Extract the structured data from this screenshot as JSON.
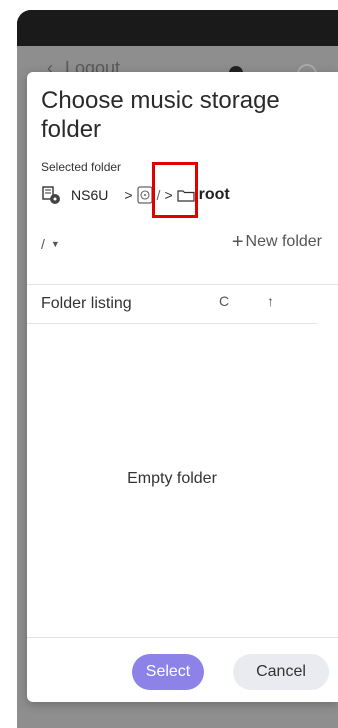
{
  "background_app": {
    "nav_label": "Logout"
  },
  "dialog": {
    "title": "Choose music storage folder",
    "selected_folder_label": "Selected folder",
    "breadcrumb": {
      "device": "NS6U",
      "separator": ">",
      "volume_path": "/",
      "root": "root"
    },
    "path_select": "/",
    "new_folder_label": "New folder",
    "listing": {
      "title": "Folder listing",
      "refresh_glyph": "C",
      "up_glyph": "↑",
      "empty_text": "Empty folder"
    },
    "select_label": "Select",
    "cancel_label": "Cancel"
  },
  "colors": {
    "primary": "#8c82e8",
    "secondary": "#e9ebf0",
    "highlight": "#e00000"
  },
  "icons": [
    "device-icon",
    "volume-icon",
    "folder-icon",
    "chevron-right-icon",
    "caret-down-icon",
    "plus-icon",
    "refresh-icon",
    "arrow-up-icon"
  ]
}
